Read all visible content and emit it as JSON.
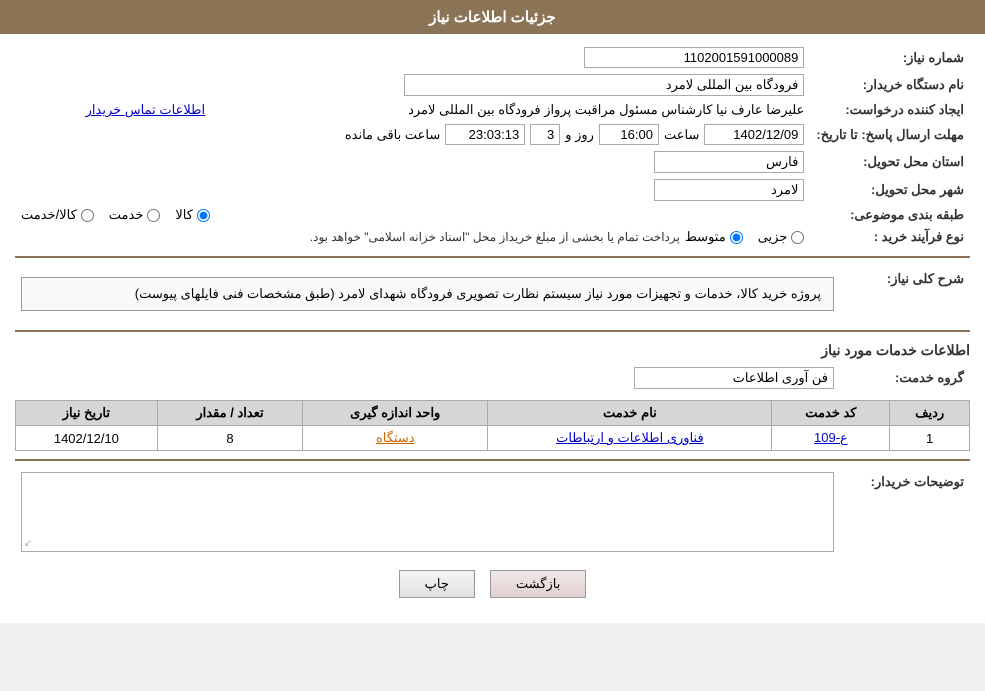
{
  "header": {
    "title": "جزئیات اطلاعات نیاز"
  },
  "fields": {
    "shomareNiaz_label": "شماره نیاز:",
    "shomareNiaz_value": "1102001591000089",
    "namDastgah_label": "نام دستگاه خریدار:",
    "namDastgah_value": "فرودگاه بین المللی لامرد",
    "ijadKonande_label": "ایجاد کننده درخواست:",
    "ijadKonande_value": "علیرضا عارف نیا کارشناس مسئول مراقبت پرواز فرودگاه بین المللی لامرد",
    "ijadKonande_link": "اطلاعات تماس خریدار",
    "mohlat_label": "مهلت ارسال پاسخ: تا تاریخ:",
    "mohlat_date": "1402/12/09",
    "mohlat_saat_label": "ساعت",
    "mohlat_saat_value": "16:00",
    "mohlat_rooz_label": "روز و",
    "mohlat_rooz_value": "3",
    "mohlat_remaining": "23:03:13",
    "mohlat_remaining_label": "ساعت باقی مانده",
    "ostan_label": "استان محل تحویل:",
    "ostan_value": "فارس",
    "shahr_label": "شهر محل تحویل:",
    "shahr_value": "لامرد",
    "tabaqe_label": "طبقه بندی موضوعی:",
    "tabaqe_kala": "کالا",
    "tabaqe_khedmat": "خدمت",
    "tabaqe_kala_khedmat": "کالا/خدمت",
    "noeFarayand_label": "نوع فرآیند خرید :",
    "noeFarayand_jazee": "جزیی",
    "noeFarayand_motavasset": "متوسط",
    "noeFarayand_notice": "پرداخت تمام یا بخشی از مبلغ خریداز محل \"اسناد خزانه اسلامی\" خواهد بود.",
    "sharhKoli_label": "شرح کلی نیاز:",
    "sharhKoli_value": "پروژه خرید کالا، خدمات و تجهیزات مورد نیاز سیستم نظارت تصویری فرودگاه شهدای لامرد (طبق مشخصات فنی فایلهای پیوست)",
    "khadamat_label": "اطلاعات خدمات مورد نیاز",
    "garohKhedmat_label": "گروه خدمت:",
    "garohKhedmat_value": "فن آوری اطلاعات",
    "table_headers": [
      "ردیف",
      "کد خدمت",
      "نام خدمت",
      "واحد اندازه گیری",
      "تعداد / مقدار",
      "تاریخ نیاز"
    ],
    "table_rows": [
      {
        "radif": "1",
        "kod": "ع-109",
        "naam": "فناوری اطلاعات و ارتباطات",
        "vahed": "دستگاه",
        "tedad": "8",
        "tarikh": "1402/12/10"
      }
    ],
    "tavasihat_label": "توضیحات خریدار:",
    "btn_print": "چاپ",
    "btn_back": "بازگشت"
  }
}
